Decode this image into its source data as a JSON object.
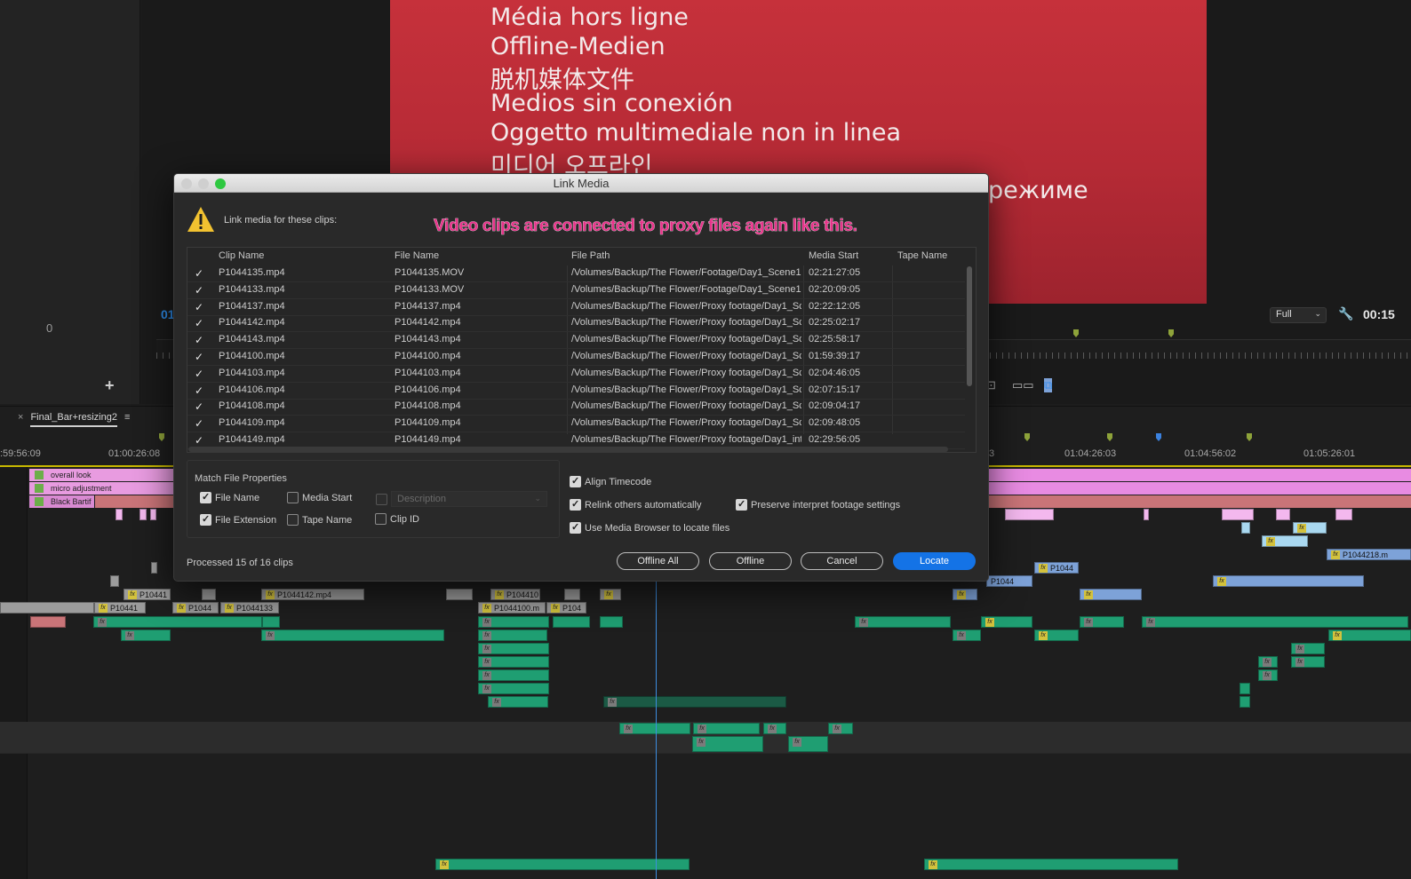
{
  "monitor": {
    "left_counter": "0",
    "add_symbol": "+",
    "timecode_left": "01",
    "zoom": "Full",
    "timecode_right": "00:15",
    "offline_lines": [
      "Média hors ligne",
      "Offline-Medien",
      "脱机媒体文件",
      "Medios sin conexión",
      "Oggetto multimediale non in linea",
      "미디어 오프라인",
      "режиме"
    ]
  },
  "timeline": {
    "sequence_name": "Final_Bar+resizing2",
    "close": "×",
    "menu": "≡",
    "ruler_ticks": [
      ":59:56:09",
      "01:00:26:08",
      "3",
      "01:04:26:03",
      "01:04:56:02",
      "01:05:26:01"
    ],
    "adjustment_layers": [
      "overall look",
      "micro adjustment",
      "Black Bartif"
    ],
    "clip_labels": [
      "P10441",
      "P10441",
      "P1044",
      "P1044133",
      "P1044142.mp4",
      "P104410",
      "P1044100.m",
      "P104",
      "P1044",
      "P1044",
      "P1044218.m"
    ]
  },
  "dialog": {
    "title": "Link Media",
    "prompt": "Link media for these clips:",
    "annotation": "Video clips are connected to proxy files again like this.",
    "columns": [
      "Clip Name",
      "File Name",
      "File Path",
      "Media Start",
      "Tape Name"
    ],
    "rows": [
      {
        "clip": "P1044135.mp4",
        "file": "P1044135.MOV",
        "path": "/Volumes/Backup/The Flower/Footage/Day1_Scene1",
        "start": "02:21:27:05",
        "tape": ""
      },
      {
        "clip": "P1044133.mp4",
        "file": "P1044133.MOV",
        "path": "/Volumes/Backup/The Flower/Footage/Day1_Scene1",
        "start": "02:20:09:05",
        "tape": ""
      },
      {
        "clip": "P1044137.mp4",
        "file": "P1044137.mp4",
        "path": "/Volumes/Backup/The Flower/Proxy footage/Day1_Sce",
        "start": "02:22:12:05",
        "tape": ""
      },
      {
        "clip": "P1044142.mp4",
        "file": "P1044142.mp4",
        "path": "/Volumes/Backup/The Flower/Proxy footage/Day1_Sce",
        "start": "02:25:02:17",
        "tape": ""
      },
      {
        "clip": "P1044143.mp4",
        "file": "P1044143.mp4",
        "path": "/Volumes/Backup/The Flower/Proxy footage/Day1_Sce",
        "start": "02:25:58:17",
        "tape": ""
      },
      {
        "clip": "P1044100.mp4",
        "file": "P1044100.mp4",
        "path": "/Volumes/Backup/The Flower/Proxy footage/Day1_Sce",
        "start": "01:59:39:17",
        "tape": ""
      },
      {
        "clip": "P1044103.mp4",
        "file": "P1044103.mp4",
        "path": "/Volumes/Backup/The Flower/Proxy footage/Day1_Sce",
        "start": "02:04:46:05",
        "tape": ""
      },
      {
        "clip": "P1044106.mp4",
        "file": "P1044106.mp4",
        "path": "/Volumes/Backup/The Flower/Proxy footage/Day1_Sce",
        "start": "02:07:15:17",
        "tape": ""
      },
      {
        "clip": "P1044108.mp4",
        "file": "P1044108.mp4",
        "path": "/Volumes/Backup/The Flower/Proxy footage/Day1_Sce",
        "start": "02:09:04:17",
        "tape": ""
      },
      {
        "clip": "P1044109.mp4",
        "file": "P1044109.mp4",
        "path": "/Volumes/Backup/The Flower/Proxy footage/Day1_Sce",
        "start": "02:09:48:05",
        "tape": ""
      },
      {
        "clip": "P1044149.mp4",
        "file": "P1044149.mp4",
        "path": "/Volumes/Backup/The Flower/Proxy footage/Day1_intr",
        "start": "02:29:56:05",
        "tape": ""
      }
    ],
    "match_group_label": "Match File Properties",
    "match_options": {
      "file_name": {
        "label": "File Name",
        "checked": true
      },
      "media_start": {
        "label": "Media Start",
        "checked": false
      },
      "description": {
        "label": "Description",
        "checked": false
      },
      "file_extension": {
        "label": "File Extension",
        "checked": true
      },
      "tape_name": {
        "label": "Tape Name",
        "checked": false
      },
      "clip_id": {
        "label": "Clip ID",
        "checked": false
      }
    },
    "options": {
      "align_timecode": {
        "label": "Align Timecode",
        "checked": true
      },
      "relink_others": {
        "label": "Relink others automatically",
        "checked": true
      },
      "preserve_interpret": {
        "label": "Preserve interpret footage settings",
        "checked": true
      },
      "use_media_browser": {
        "label": "Use Media Browser to locate files",
        "checked": true
      }
    },
    "status": "Processed 15 of 16 clips",
    "buttons": {
      "offline_all": "Offline All",
      "offline": "Offline",
      "cancel": "Cancel",
      "locate": "Locate"
    }
  },
  "colors": {
    "accent": "#1473e6",
    "annotation": "#e8338a",
    "offline_red": "#c6313b",
    "playhead": "#3d8de0"
  }
}
